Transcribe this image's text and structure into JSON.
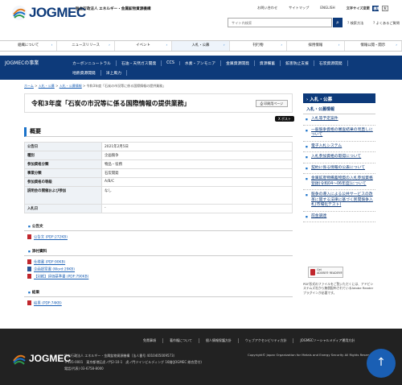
{
  "header": {
    "logo_text": "JOGMEC",
    "org_name": "独立行政法人 エネルギー・金属鉱物資源機構",
    "toplinks": [
      "お問い合わせ",
      "サイトマップ",
      "ENGLISH"
    ],
    "font_size_label": "文字サイズ変更",
    "font_size_std": "標準",
    "font_size_large": "大",
    "search_placeholder": "サイト内検索",
    "search_option": "検索方法",
    "search_option2": "よくあるご質問"
  },
  "gnav": [
    "組織について",
    "ニュースリリース",
    "イベント",
    "入札・公募",
    "刊行物",
    "採用情報",
    "情報公開・開示"
  ],
  "subnav": {
    "title": "JOGMECの事業",
    "row1": [
      "カーボンニュートラル",
      "石油・天然ガス開発",
      "CCS",
      "水素・アンモニア",
      "金属資源開発",
      "資源備蓄",
      "鉱害防止支援",
      "石炭資源開発"
    ],
    "row2": [
      "地熱資源開発",
      "洋上風力"
    ]
  },
  "breadcrumb": {
    "items": [
      "ホーム",
      "入札・公募",
      "入札・公募情報"
    ],
    "current": "令和3年度「石炭の市況等に係る国際情報の提供業務」"
  },
  "page": {
    "title": "令和3年度「石炭の市況等に係る国際情報の提供業務」",
    "print_label": "印刷用ページ",
    "post_label": "X ポスト"
  },
  "overview": {
    "heading": "概要",
    "rows": [
      {
        "k": "公告日",
        "v": "2021年2月5日"
      },
      {
        "k": "種別",
        "v": "企画競争"
      },
      {
        "k": "参加資格分類",
        "v": "物品・役務"
      },
      {
        "k": "事業分類",
        "v": "石炭開発"
      },
      {
        "k": "参加資格の等級",
        "v": "A/B/C"
      },
      {
        "k": "説明会の開催および参加",
        "v": "なし"
      },
      {
        "k": "入札日",
        "v": "-"
      }
    ]
  },
  "notice": {
    "heading": "公告文",
    "files": [
      {
        "label": "公告文 (PDF:272KB)",
        "type": "pdf"
      }
    ]
  },
  "attachments": {
    "heading": "添付資料",
    "files": [
      {
        "label": "仕様書 (PDF:90KB)",
        "type": "pdf"
      },
      {
        "label": "企画提案書 (Word:29KB)",
        "type": "word"
      },
      {
        "label": "【別紙】評価基準書 (PDF:790KB)",
        "type": "pdf"
      }
    ]
  },
  "result": {
    "heading": "結果",
    "files": [
      {
        "label": "結果 (PDF:74KB)",
        "type": "pdf"
      }
    ]
  },
  "sidebar": {
    "heading": "入札・公募",
    "subheading": "入札・公募情報",
    "items": [
      "入札等予定案件",
      "一般競争資格の審査結果の見直しについて",
      "電子入札システム",
      "入札参加資格の取得について",
      "契約に係る情報の公表について",
      "金属鉱産物備蓄物資の入札参加資格登録(令和04〜06年度)について",
      "競争の導入による公共サービスの改革に関する法律に基づく民間競争入札(市場化テスト)",
      "前金調達"
    ],
    "adobe_label1": "Get",
    "adobe_label2": "ADOBE® READER®",
    "adobe_note": "PDF形式のファイルをご覧いただくには、アドビシステムズ社から無償配布されているAdobe Readerプラグインが必要です。"
  },
  "footer": {
    "links": [
      "免責事項",
      "著作権について",
      "個人情報保護方針",
      "ウェブアクセシビリティ方針",
      "JOGMECソーシャルメディア運用方針"
    ],
    "logo_text": "JOGMEC",
    "addr1": "独立行政法人 エネルギー・金属鉱物資源機構（法人番号 4010405009573）",
    "addr2": "〒105-0001　東京都港区虎ノ門2-10-1　虎ノ門ツインビルディング 16階(JOGMEC 総合受付)",
    "addr3": "電話(代表) 03-6758-8000",
    "copyright": "Copyright© Japan Organization for Metals and Energy Security All Rights Reserved.",
    "pagetop": "↑"
  }
}
